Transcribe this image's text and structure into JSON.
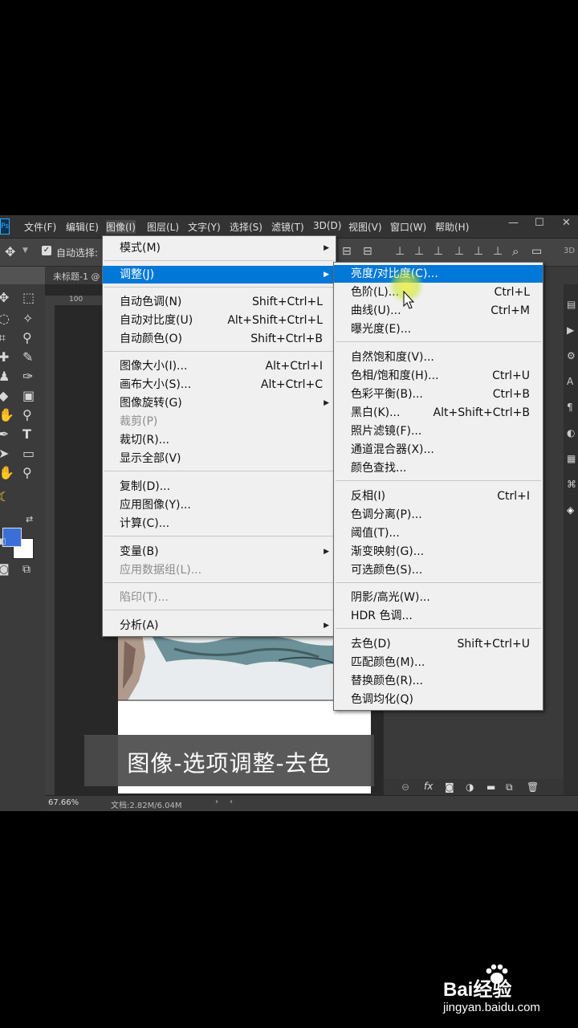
{
  "menubar": {
    "items": [
      "文件(F)",
      "编辑(E)",
      "图像(I)",
      "图层(L)",
      "文字(Y)",
      "选择(S)",
      "滤镜(T)",
      "3D(D)",
      "视图(V)",
      "窗口(W)",
      "帮助(H)"
    ],
    "window_controls": [
      "—",
      "☐",
      "✕"
    ]
  },
  "optionsbar": {
    "auto_select_label": "自动选择:",
    "panel_label": "3D"
  },
  "document": {
    "tab_title": "未标题-1 @",
    "ruler_label": "100"
  },
  "statusbar": {
    "zoom": "67.66%",
    "doc_info": "文档:2.82M/6.04M"
  },
  "image_menu": [
    {
      "label": "模式(M)",
      "shortcut": "",
      "submenu": true
    },
    {
      "label": "调整(J)",
      "shortcut": "",
      "submenu": true,
      "highlighted": true
    },
    {
      "label": "自动色调(N)",
      "shortcut": "Shift+Ctrl+L"
    },
    {
      "label": "自动对比度(U)",
      "shortcut": "Alt+Shift+Ctrl+L"
    },
    {
      "label": "自动颜色(O)",
      "shortcut": "Shift+Ctrl+B"
    },
    {
      "label": "图像大小(I)...",
      "shortcut": "Alt+Ctrl+I"
    },
    {
      "label": "画布大小(S)...",
      "shortcut": "Alt+Ctrl+C"
    },
    {
      "label": "图像旋转(G)",
      "shortcut": "",
      "submenu": true
    },
    {
      "label": "裁剪(P)",
      "shortcut": "",
      "disabled": true
    },
    {
      "label": "裁切(R)...",
      "shortcut": ""
    },
    {
      "label": "显示全部(V)",
      "shortcut": ""
    },
    {
      "label": "复制(D)...",
      "shortcut": ""
    },
    {
      "label": "应用图像(Y)...",
      "shortcut": ""
    },
    {
      "label": "计算(C)...",
      "shortcut": ""
    },
    {
      "label": "变量(B)",
      "shortcut": "",
      "submenu": true
    },
    {
      "label": "应用数据组(L)...",
      "shortcut": "",
      "disabled": true
    },
    {
      "label": "陷印(T)...",
      "shortcut": "",
      "disabled": true
    },
    {
      "label": "分析(A)",
      "shortcut": "",
      "submenu": true
    }
  ],
  "adjust_submenu": [
    {
      "label": "亮度/对比度(C)...",
      "shortcut": "",
      "highlighted": true
    },
    {
      "label": "色阶(L)...",
      "shortcut": "Ctrl+L"
    },
    {
      "label": "曲线(U)...",
      "shortcut": "Ctrl+M"
    },
    {
      "label": "曝光度(E)...",
      "shortcut": ""
    },
    {
      "label": "自然饱和度(V)...",
      "shortcut": ""
    },
    {
      "label": "色相/饱和度(H)...",
      "shortcut": "Ctrl+U"
    },
    {
      "label": "色彩平衡(B)...",
      "shortcut": "Ctrl+B"
    },
    {
      "label": "黑白(K)...",
      "shortcut": "Alt+Shift+Ctrl+B"
    },
    {
      "label": "照片滤镜(F)...",
      "shortcut": ""
    },
    {
      "label": "通道混合器(X)...",
      "shortcut": ""
    },
    {
      "label": "颜色查找...",
      "shortcut": ""
    },
    {
      "label": "反相(I)",
      "shortcut": "Ctrl+I"
    },
    {
      "label": "色调分离(P)...",
      "shortcut": ""
    },
    {
      "label": "阈值(T)...",
      "shortcut": ""
    },
    {
      "label": "渐变映射(G)...",
      "shortcut": ""
    },
    {
      "label": "可选颜色(S)...",
      "shortcut": ""
    },
    {
      "label": "阴影/高光(W)...",
      "shortcut": ""
    },
    {
      "label": "HDR 色调...",
      "shortcut": ""
    },
    {
      "label": "去色(D)",
      "shortcut": "Shift+Ctrl+U"
    },
    {
      "label": "匹配颜色(M)...",
      "shortcut": ""
    },
    {
      "label": "替换颜色(R)...",
      "shortcut": ""
    },
    {
      "label": "色调均化(Q)",
      "shortcut": ""
    }
  ],
  "caption": "图像-选项调整-去色",
  "watermark": {
    "brand": "Bai经验",
    "url": "jingyan.baidu.com"
  },
  "colors": {
    "accent": "#0078d7",
    "foreground_swatch": "#3b6fd8",
    "background_swatch": "#ffffff"
  }
}
